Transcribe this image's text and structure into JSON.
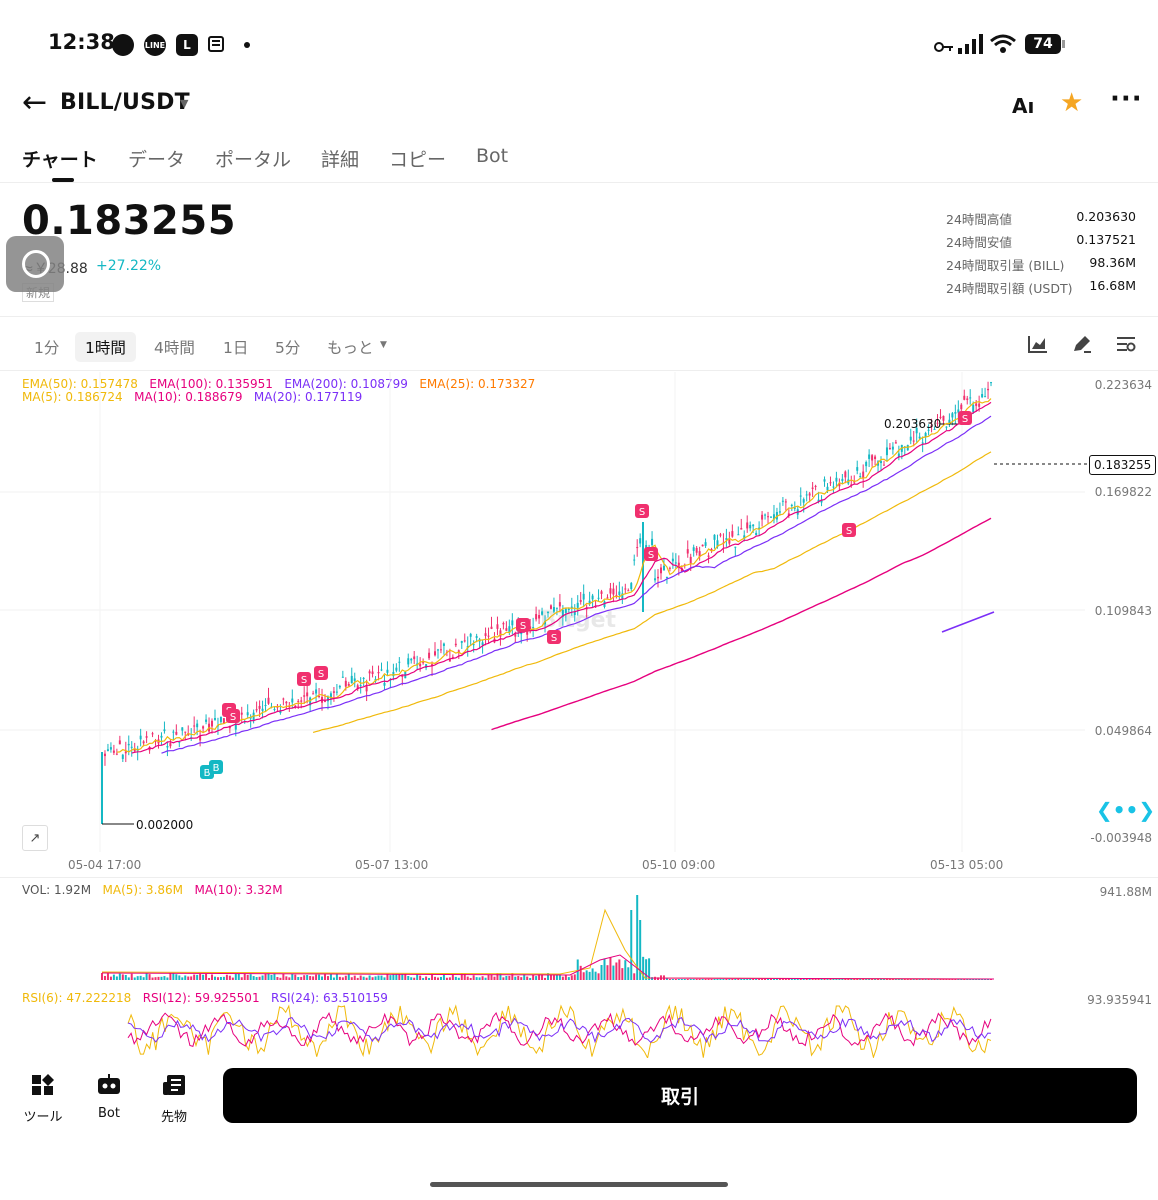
{
  "status_bar": {
    "time": "12:38",
    "battery": "74",
    "line_badge": "LINE",
    "l_badge": "L"
  },
  "header": {
    "title": "BILL/USDT",
    "ai_label": "Aı"
  },
  "tabs": [
    "チャート",
    "データ",
    "ポータル",
    "詳細",
    "コピー",
    "Bot"
  ],
  "price": {
    "last": "0.183255",
    "fiat": "≈￥28.88",
    "change": "+27.22%",
    "new_badge": "新規",
    "stats": [
      {
        "label": "24時間高値",
        "value": "0.203630"
      },
      {
        "label": "24時間安値",
        "value": "0.137521"
      },
      {
        "label": "24時間取引量 (BILL)",
        "value": "98.36M"
      },
      {
        "label": "24時間取引額 (USDT)",
        "value": "16.68M"
      }
    ]
  },
  "timeframes": [
    "1分",
    "1時間",
    "4時間",
    "1日",
    "5分",
    "もっと"
  ],
  "chart": {
    "ema_legend": [
      {
        "text": "EMA(50): 0.157478",
        "color": "#f0b90b"
      },
      {
        "text": "EMA(100): 0.135951",
        "color": "#e6007e"
      },
      {
        "text": "EMA(200): 0.108799",
        "color": "#7b2ff7"
      },
      {
        "text": "EMA(25): 0.173327",
        "color": "#ff7a00"
      }
    ],
    "ma_legend": [
      {
        "text": "MA(5): 0.186724",
        "color": "#f0b90b"
      },
      {
        "text": "MA(10): 0.188679",
        "color": "#e6007e"
      },
      {
        "text": "MA(20): 0.177119",
        "color": "#7b2ff7"
      }
    ],
    "y_ticks": [
      "0.223634",
      "0.169822",
      "0.109843",
      "0.049864",
      "-0.003948"
    ],
    "x_ticks": [
      "05-04 17:00",
      "05-07 13:00",
      "05-10 09:00",
      "05-13 05:00"
    ],
    "high_label": "0.203630",
    "low_label": "0.002000",
    "current_tag": "0.183255",
    "watermark": "Bitget",
    "sell_marker": "S",
    "buy_marker": "B"
  },
  "volume": {
    "legend": [
      {
        "text": "VOL: 1.92M",
        "color": "#555555"
      },
      {
        "text": "MA(5): 3.86M",
        "color": "#f0b90b"
      },
      {
        "text": "MA(10): 3.32M",
        "color": "#e6007e"
      }
    ],
    "max_label": "941.88M"
  },
  "rsi": {
    "legend": [
      {
        "text": "RSI(6): 47.222218",
        "color": "#f0b90b"
      },
      {
        "text": "RSI(12): 59.925501",
        "color": "#e6007e"
      },
      {
        "text": "RSI(24): 63.510159",
        "color": "#7b2ff7"
      }
    ],
    "max_label": "93.935941"
  },
  "bottom_nav": [
    {
      "label": "ツール"
    },
    {
      "label": "Bot"
    },
    {
      "label": "先物"
    }
  ],
  "trade_button": "取引",
  "colors": {
    "up": "#14b8c4",
    "down": "#f0306e",
    "accent": "#f5a623"
  }
}
